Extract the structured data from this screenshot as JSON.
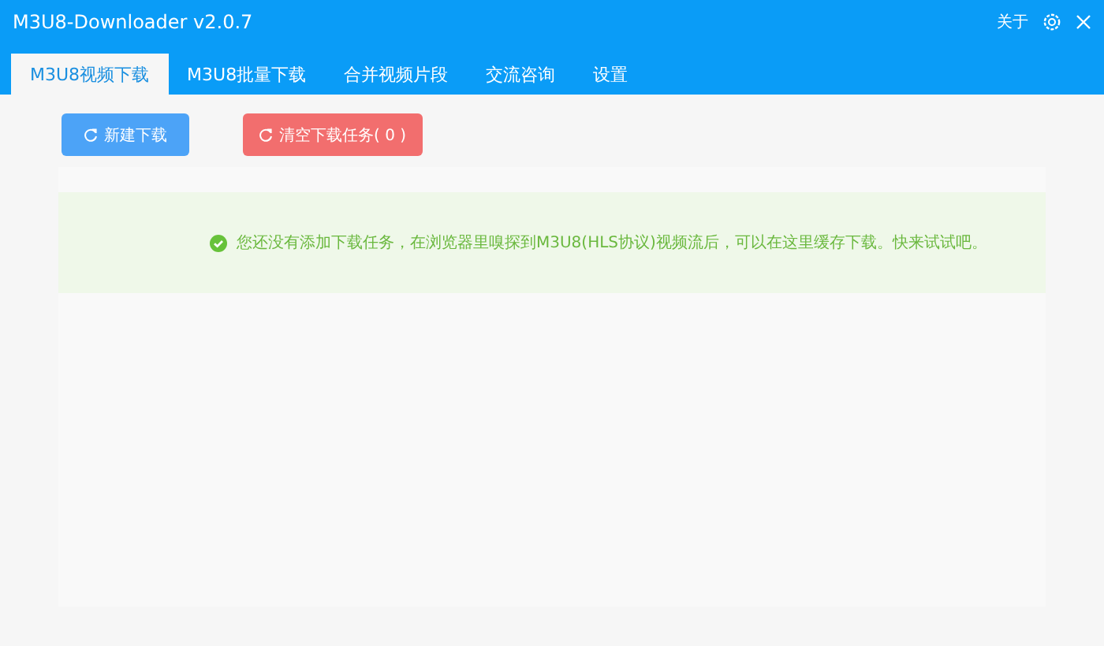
{
  "window": {
    "title": "M3U8-Downloader v2.0.7",
    "about": "关于"
  },
  "tabs": [
    {
      "label": "M3U8视频下载",
      "selected": true
    },
    {
      "label": "M3U8批量下载",
      "selected": false
    },
    {
      "label": "合并视频片段",
      "selected": false
    },
    {
      "label": "交流咨询",
      "selected": false
    },
    {
      "label": "设置",
      "selected": false
    }
  ],
  "toolbar": [
    {
      "label": "新建下载",
      "kind": "primary"
    },
    {
      "label": "清空下载任务( 0 )",
      "kind": "danger"
    }
  ],
  "notice": {
    "kind": "success",
    "text": "您还没有添加下载任务，在浏览器里嗅探到M3U8(HLS协议)视频流后，可以在这里缓存下载。快来试试吧。"
  }
}
